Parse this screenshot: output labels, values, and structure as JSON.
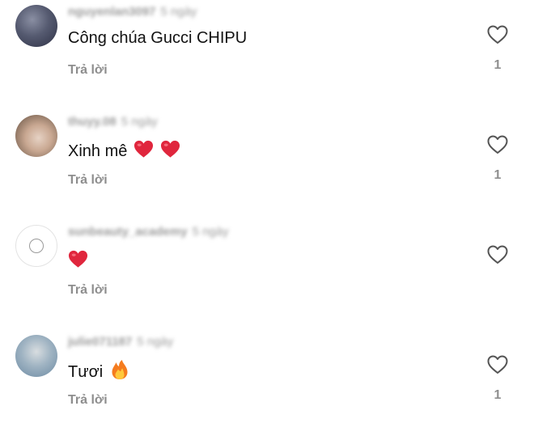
{
  "comments": [
    {
      "username": "nguyenlan3097",
      "time": "5 ngày",
      "text": "Công chúa Gucci CHIPU",
      "emojis": [],
      "reply_label": "Trả lời",
      "likes": "1"
    },
    {
      "username": "thuyy.08",
      "time": "5 ngày",
      "text": "Xinh mê",
      "emojis": [
        "red-heart",
        "red-heart"
      ],
      "reply_label": "Trả lời",
      "likes": "1"
    },
    {
      "username": "sunbeauty_academy",
      "time": "5 ngày",
      "text": "",
      "emojis": [
        "red-heart"
      ],
      "reply_label": "Trả lời",
      "likes": ""
    },
    {
      "username": "julie071187",
      "time": "5 ngày",
      "text": "Tươi",
      "emojis": [
        "fire"
      ],
      "reply_label": "Trả lời",
      "likes": "1"
    }
  ],
  "icons": {
    "like": "heart-outline-icon",
    "heart_emoji": "red-heart-emoji",
    "fire_emoji": "fire-emoji"
  },
  "colors": {
    "heart_emoji": "#e0263d",
    "muted_text": "#8e8e8e",
    "primary_text": "#111111"
  }
}
